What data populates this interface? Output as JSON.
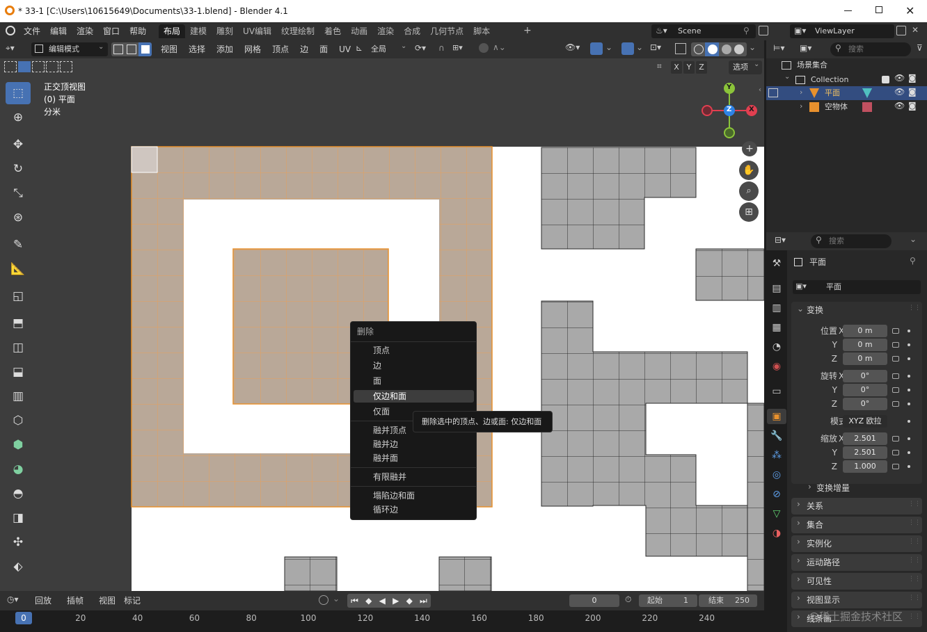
{
  "window": {
    "title": "* 33-1 [C:\\Users\\10615649\\Documents\\33-1.blend] - Blender 4.1"
  },
  "menu": [
    "文件",
    "编辑",
    "渲染",
    "窗口",
    "帮助"
  ],
  "workspaces": [
    "布局",
    "建模",
    "雕刻",
    "UV编辑",
    "纹理绘制",
    "着色",
    "动画",
    "渲染",
    "合成",
    "几何节点",
    "脚本"
  ],
  "active_workspace": "布局",
  "scene": "Scene",
  "view_layer": "ViewLayer",
  "viewport_header": {
    "mode": "编辑模式",
    "menus": [
      "视图",
      "选择",
      "添加",
      "网格",
      "顶点",
      "边",
      "面",
      "UV"
    ],
    "transform_orientation": "全局"
  },
  "viewport_header2": {
    "axes": [
      "X",
      "Y",
      "Z"
    ],
    "options": "选项"
  },
  "overlay_text": {
    "view_name": "正交顶视图",
    "object": "(0) 平面",
    "units": "分米"
  },
  "gizmo": {
    "x": "X",
    "y": "Y",
    "z": "Z"
  },
  "context_menu": {
    "title": "删除",
    "items": [
      "顶点",
      "边",
      "面",
      "仅边和面",
      "仅面",
      "融并顶点",
      "融并边",
      "融并面",
      "有限融并",
      "塌陷边和面",
      "循环边"
    ],
    "highlighted": "仅边和面",
    "tooltip": "删除选中的顶点、边或面: 仅边和面"
  },
  "outliner": {
    "search_placeholder": "搜索",
    "root": "场景集合",
    "collection": "Collection",
    "items": [
      "平面",
      "空物体"
    ]
  },
  "properties": {
    "search_placeholder": "搜索",
    "object_name": "平面",
    "data_name": "平面",
    "section_transform": "变换",
    "location_label": "位置",
    "rotation_label": "旋转",
    "scale_label": "缩放",
    "axes": [
      "X",
      "Y",
      "Z"
    ],
    "location": [
      "0 m",
      "0 m",
      "0 m"
    ],
    "rotation": [
      "0°",
      "0°",
      "0°"
    ],
    "mode_label": "模式",
    "rotation_mode": "XYZ 欧拉",
    "scale": [
      "2.501",
      "2.501",
      "1.000"
    ],
    "delta_transform": "变换增量",
    "sections": [
      "关系",
      "集合",
      "实例化",
      "运动路径",
      "可见性",
      "视图显示",
      "线条画"
    ]
  },
  "timeline": {
    "menus": [
      "回放",
      "插帧",
      "视图",
      "标记"
    ],
    "current_frame": "0",
    "start_label": "起始",
    "start": "1",
    "end_label": "结束",
    "end": "250",
    "ruler": [
      "0",
      "20",
      "40",
      "60",
      "80",
      "100",
      "120",
      "140",
      "160",
      "180",
      "200",
      "220",
      "240"
    ]
  },
  "watermark": "@稀土掘金技术社区",
  "colors": {
    "selection": "#e8912d",
    "active_blue": "#4772b3",
    "mesh_face_selected": "#b8a697",
    "mesh_face_gray": "#a9a9a9",
    "gizmo_x": "#e13f50",
    "gizmo_y": "#8bc43a",
    "gizmo_z": "#2f83e6"
  }
}
